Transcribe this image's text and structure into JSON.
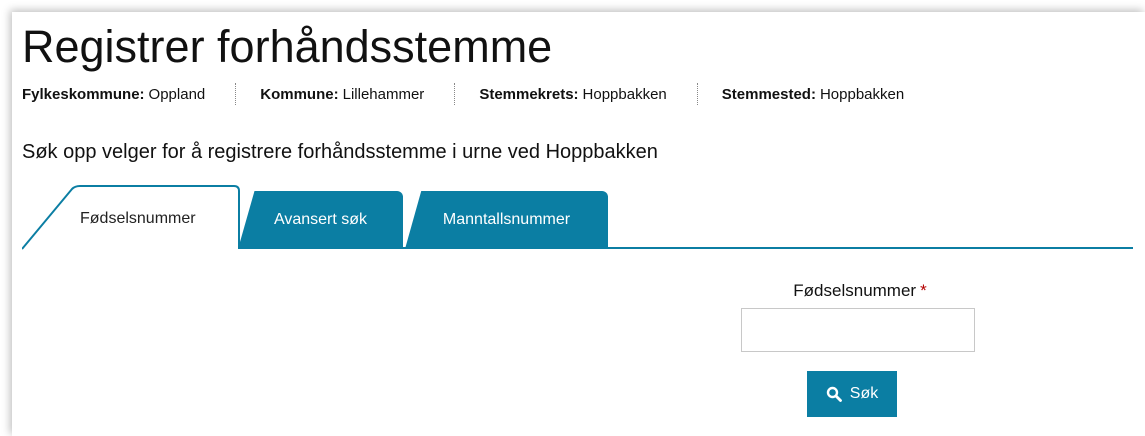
{
  "page": {
    "title": "Registrer forhåndsstemme"
  },
  "meta": {
    "fylkeskommune_label": "Fylkeskommune:",
    "fylkeskommune_value": "Oppland",
    "kommune_label": "Kommune:",
    "kommune_value": "Lillehammer",
    "stemmekrets_label": "Stemmekrets:",
    "stemmekrets_value": "Hoppbakken",
    "stemmested_label": "Stemmested:",
    "stemmested_value": "Hoppbakken"
  },
  "lead": "Søk opp velger for å registrere forhåndsstemme i urne ved Hoppbakken",
  "tabs": [
    {
      "label": "Fødselsnummer",
      "active": true
    },
    {
      "label": "Avansert søk",
      "active": false
    },
    {
      "label": "Manntallsnummer",
      "active": false
    }
  ],
  "form": {
    "field_label": "Fødselsnummer",
    "required_mark": "*",
    "field_value": "",
    "search_label": "Søk",
    "search_icon": "search-icon"
  },
  "colors": {
    "accent": "#0b7ea3",
    "required": "#b40000"
  }
}
